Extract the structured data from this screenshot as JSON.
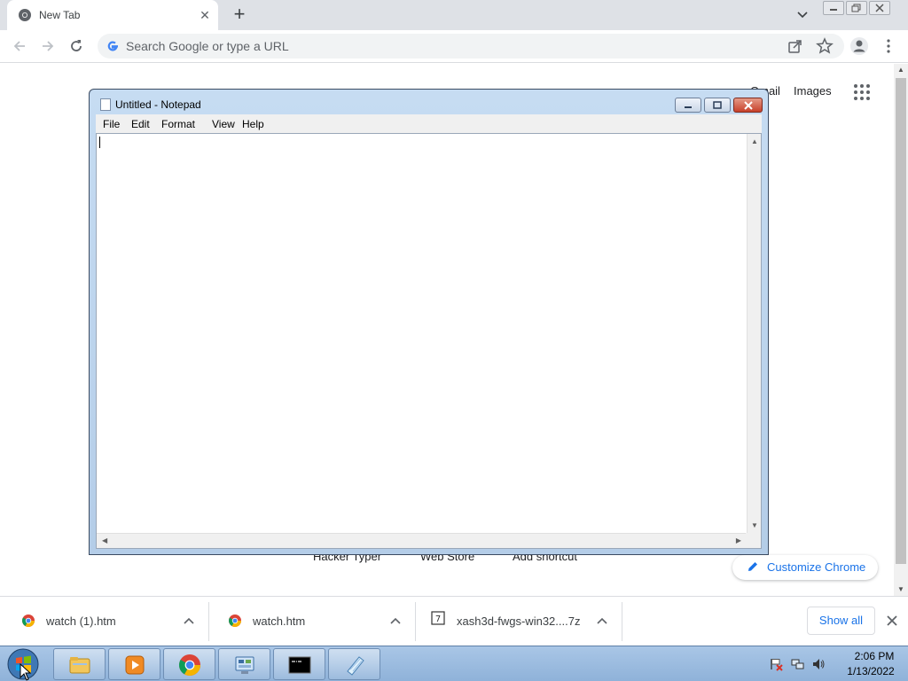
{
  "browser": {
    "tab_title": "New Tab",
    "tab_close_glyph": "✕",
    "new_tab_glyph": "+",
    "omnibox_placeholder": "Search Google or type a URL"
  },
  "ntp": {
    "gmail_label": "Gmail",
    "images_label": "Images",
    "shortcuts": [
      "Hacker Typer",
      "Web Store",
      "Add shortcut"
    ],
    "customize_label": "Customize Chrome"
  },
  "notepad": {
    "title": "Untitled - Notepad",
    "menu": [
      "File",
      "Edit",
      "Format",
      "View",
      "Help"
    ],
    "content": ""
  },
  "downloads": {
    "items": [
      {
        "name": "watch (1).htm",
        "icon": "chrome-icon"
      },
      {
        "name": "watch.htm",
        "icon": "chrome-icon"
      },
      {
        "name": "xash3d-fwgs-win32....7z",
        "icon": "archive-icon"
      }
    ],
    "show_all_label": "Show all"
  },
  "taskbar": {
    "apps": [
      "windows-explorer",
      "media-player",
      "google-chrome",
      "control-panel",
      "command-prompt",
      "notepad"
    ],
    "clock_time": "2:06 PM",
    "clock_date": "1/13/2022"
  },
  "colors": {
    "chrome_frame": "#dee1e6",
    "link_blue": "#1a73e8",
    "taskbar": "#a9c6e6"
  }
}
